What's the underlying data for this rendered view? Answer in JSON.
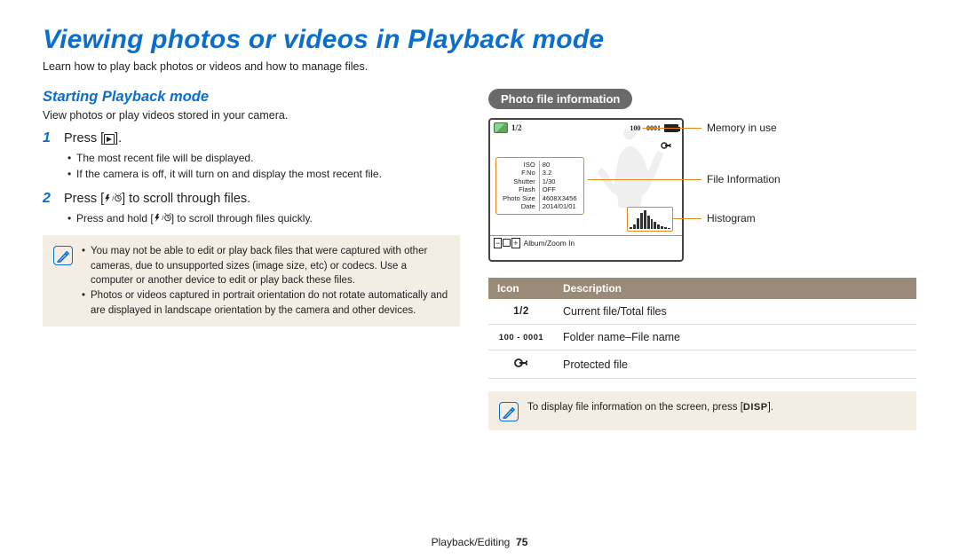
{
  "title": "Viewing photos or videos in Playback mode",
  "lead": "Learn how to play back photos or videos and how to manage files.",
  "left": {
    "subhead": "Starting Playback mode",
    "intro": "View photos or play videos stored in your camera.",
    "step1_num": "1",
    "step1_pre": "Press [",
    "step1_post": "].",
    "step1_b1": "The most recent file will be displayed.",
    "step1_b2": "If the camera is off, it will turn on and display the most recent file.",
    "step2_num": "2",
    "step2_pre": "Press [",
    "step2_post": "] to scroll through files.",
    "step2_b1_pre": "Press and hold [",
    "step2_b1_post": "] to scroll through files quickly.",
    "note1": "You may not be able to edit or play back files that were captured with other cameras, due to unsupported sizes (image size, etc) or codecs. Use a computer or another device to edit or play back these files.",
    "note2": "Photos or videos captured in portrait orientation do not rotate automatically and are displayed in landscape orientation by the camera and other devices."
  },
  "right": {
    "pill": "Photo file information",
    "lcd": {
      "counter": "1/2",
      "folderfile": "100 - 0001",
      "info": {
        "iso_k": "ISO",
        "iso_v": "80",
        "fno_k": "F.No",
        "fno_v": "3.2",
        "sh_k": "Shutter",
        "sh_v": "1/30",
        "fl_k": "Flash",
        "fl_v": "OFF",
        "ps_k": "Photo Size",
        "ps_v": "4608X3456",
        "dt_k": "Date",
        "dt_v": "2014/01/01"
      },
      "bottom": "Album/Zoom In"
    },
    "annot": {
      "a1": "Memory in use",
      "a2": "File Information",
      "a3": "Histogram"
    },
    "table": {
      "h1": "Icon",
      "h2": "Description",
      "r1_icon": "1/2",
      "r1_desc": "Current file/Total files",
      "r2_icon": "100 - 0001",
      "r2_desc": "Folder name–File name",
      "r3_desc": "Protected file"
    },
    "tip_pre": "To display file information on the screen, press [",
    "tip_disp": "DISP",
    "tip_post": "]."
  },
  "footer": {
    "section": "Playback/Editing",
    "page": "75"
  }
}
